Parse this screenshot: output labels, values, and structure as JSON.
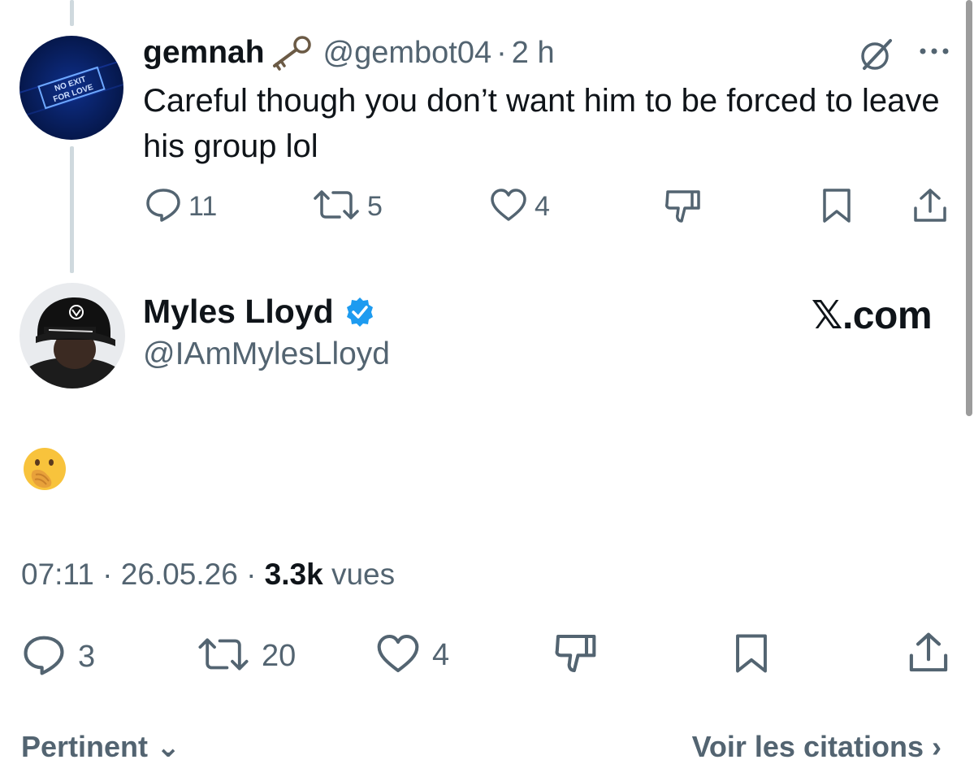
{
  "reply": {
    "display_name": "gemnah",
    "name_emoji": "old-key-emoji",
    "handle": "@gembot04",
    "separator": "·",
    "time": "2 h",
    "text": "Careful though you don’t want him to be forced to leave his group lol",
    "avatar_text_line1": "NO EXIT",
    "avatar_text_line2": "FOR LOVE",
    "counts": {
      "replies": "11",
      "reposts": "5",
      "likes": "4"
    },
    "icons": [
      "grok-icon",
      "more-icon",
      "reply-icon",
      "repost-icon",
      "like-icon",
      "dislike-icon",
      "bookmark-icon",
      "share-icon"
    ]
  },
  "main_tweet": {
    "display_name": "Myles Lloyd",
    "verified": true,
    "handle": "@IAmMylesLloyd",
    "watermark": "𝕏.com",
    "emoji": "face-with-hand-over-mouth",
    "timestamp": "07:11",
    "date": "26.05.26",
    "separator": "·",
    "views_count": "3.3k",
    "views_label": "vues",
    "counts": {
      "replies": "3",
      "reposts": "20",
      "likes": "4"
    }
  },
  "bottom_bar": {
    "left_label": "Pertinent",
    "right_label": "Voir les citations"
  },
  "colors": {
    "text_primary": "#0f1419",
    "text_secondary": "#536471",
    "verified_blue": "#1d9bf0",
    "thread_line": "#cfd9de"
  }
}
